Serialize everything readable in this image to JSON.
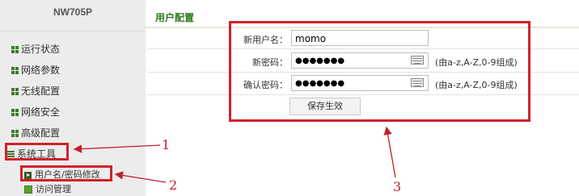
{
  "sidebar": {
    "brand": "NW705P",
    "items": [
      {
        "label": "运行状态",
        "icon": "grid-icon"
      },
      {
        "label": "网络参数",
        "icon": "grid-icon"
      },
      {
        "label": "无线配置",
        "icon": "grid-icon"
      },
      {
        "label": "网络安全",
        "icon": "grid-icon"
      },
      {
        "label": "高级配置",
        "icon": "grid-icon"
      },
      {
        "label": "系统工具",
        "icon": "list-icon"
      }
    ],
    "subitems": [
      {
        "label": "用户名/密码修改",
        "icon": "play-icon"
      },
      {
        "label": "访问管理",
        "icon": "square-icon"
      }
    ]
  },
  "main": {
    "title": "用户配置",
    "form": {
      "username_label": "新用户名：",
      "username_value": "momo",
      "password_label": "新密码：",
      "password_value": "●●●●●●●",
      "password_hint": "(由a-z,A-Z,0-9组成)",
      "confirm_label": "确认密码：",
      "confirm_value": "●●●●●●●",
      "confirm_hint": "(由a-z,A-Z,0-9组成)",
      "save_label": "保存生效"
    }
  },
  "annotations": {
    "num1": "1",
    "num2": "2",
    "num3": "3",
    "color": "#d3202a"
  },
  "colors": {
    "accent": "#2f7a1f",
    "sidebar_bg": "#ececec"
  }
}
